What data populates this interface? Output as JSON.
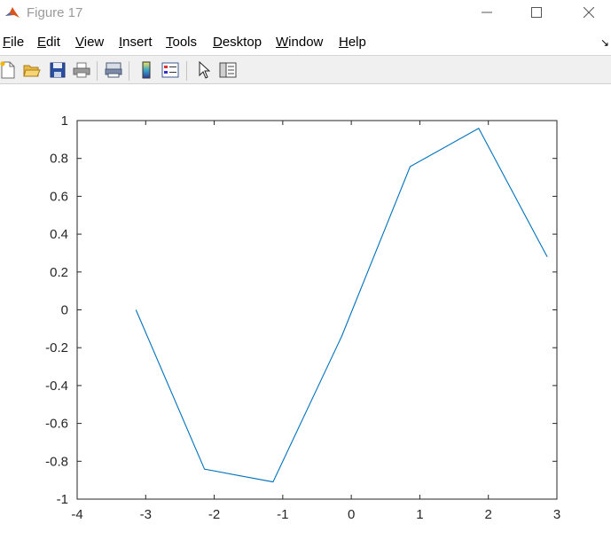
{
  "window": {
    "title": "Figure 17"
  },
  "menu": {
    "items": [
      {
        "u": "F",
        "rest": "ile"
      },
      {
        "u": "E",
        "rest": "dit"
      },
      {
        "u": "V",
        "rest": "iew"
      },
      {
        "u": "I",
        "rest": "nsert"
      },
      {
        "u": "T",
        "rest": "ools"
      },
      {
        "u": "D",
        "rest": "esktop"
      },
      {
        "u": "W",
        "rest": "indow"
      },
      {
        "u": "H",
        "rest": "elp"
      }
    ]
  },
  "toolbar": {
    "buttons": [
      "new-figure-icon",
      "open-file-icon",
      "save-icon",
      "print-icon",
      "link-plot-icon",
      "colorbar-icon",
      "legend-icon",
      "pointer-icon",
      "property-inspector-icon"
    ]
  },
  "colors": {
    "line": "#0072bd",
    "axis": "#262626"
  },
  "chart_data": {
    "type": "line",
    "x": [
      -3.1416,
      -2.1416,
      -1.1416,
      -0.1416,
      0.8584,
      1.8584,
      2.8584
    ],
    "y": [
      0.0,
      -0.8415,
      -0.9093,
      -0.1411,
      0.7568,
      0.9589,
      0.2794
    ],
    "xlim": [
      -4,
      3
    ],
    "ylim": [
      -1,
      1
    ],
    "xticks": [
      "-4",
      "-3",
      "-2",
      "-1",
      "0",
      "1",
      "2",
      "3"
    ],
    "yticks": [
      "1",
      "0.8",
      "0.6",
      "0.4",
      "0.2",
      "0",
      "-0.2",
      "-0.4",
      "-0.6",
      "-0.8",
      "-1"
    ],
    "grid": false,
    "title": "",
    "xlabel": "",
    "ylabel": ""
  }
}
